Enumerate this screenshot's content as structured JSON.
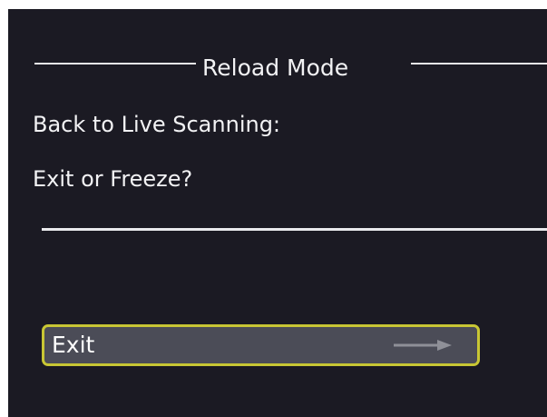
{
  "dialog": {
    "title": "Reload Mode",
    "line1": "Back to Live Scanning:",
    "line2": "Exit or Freeze?",
    "button": {
      "label": "Exit",
      "icon": "arrow-right-icon"
    }
  },
  "colors": {
    "background": "#1b1a23",
    "text": "#f2f2f4",
    "button_fill": "#4b4c57",
    "button_border": "#c8c634",
    "arrow": "#8f9098"
  }
}
